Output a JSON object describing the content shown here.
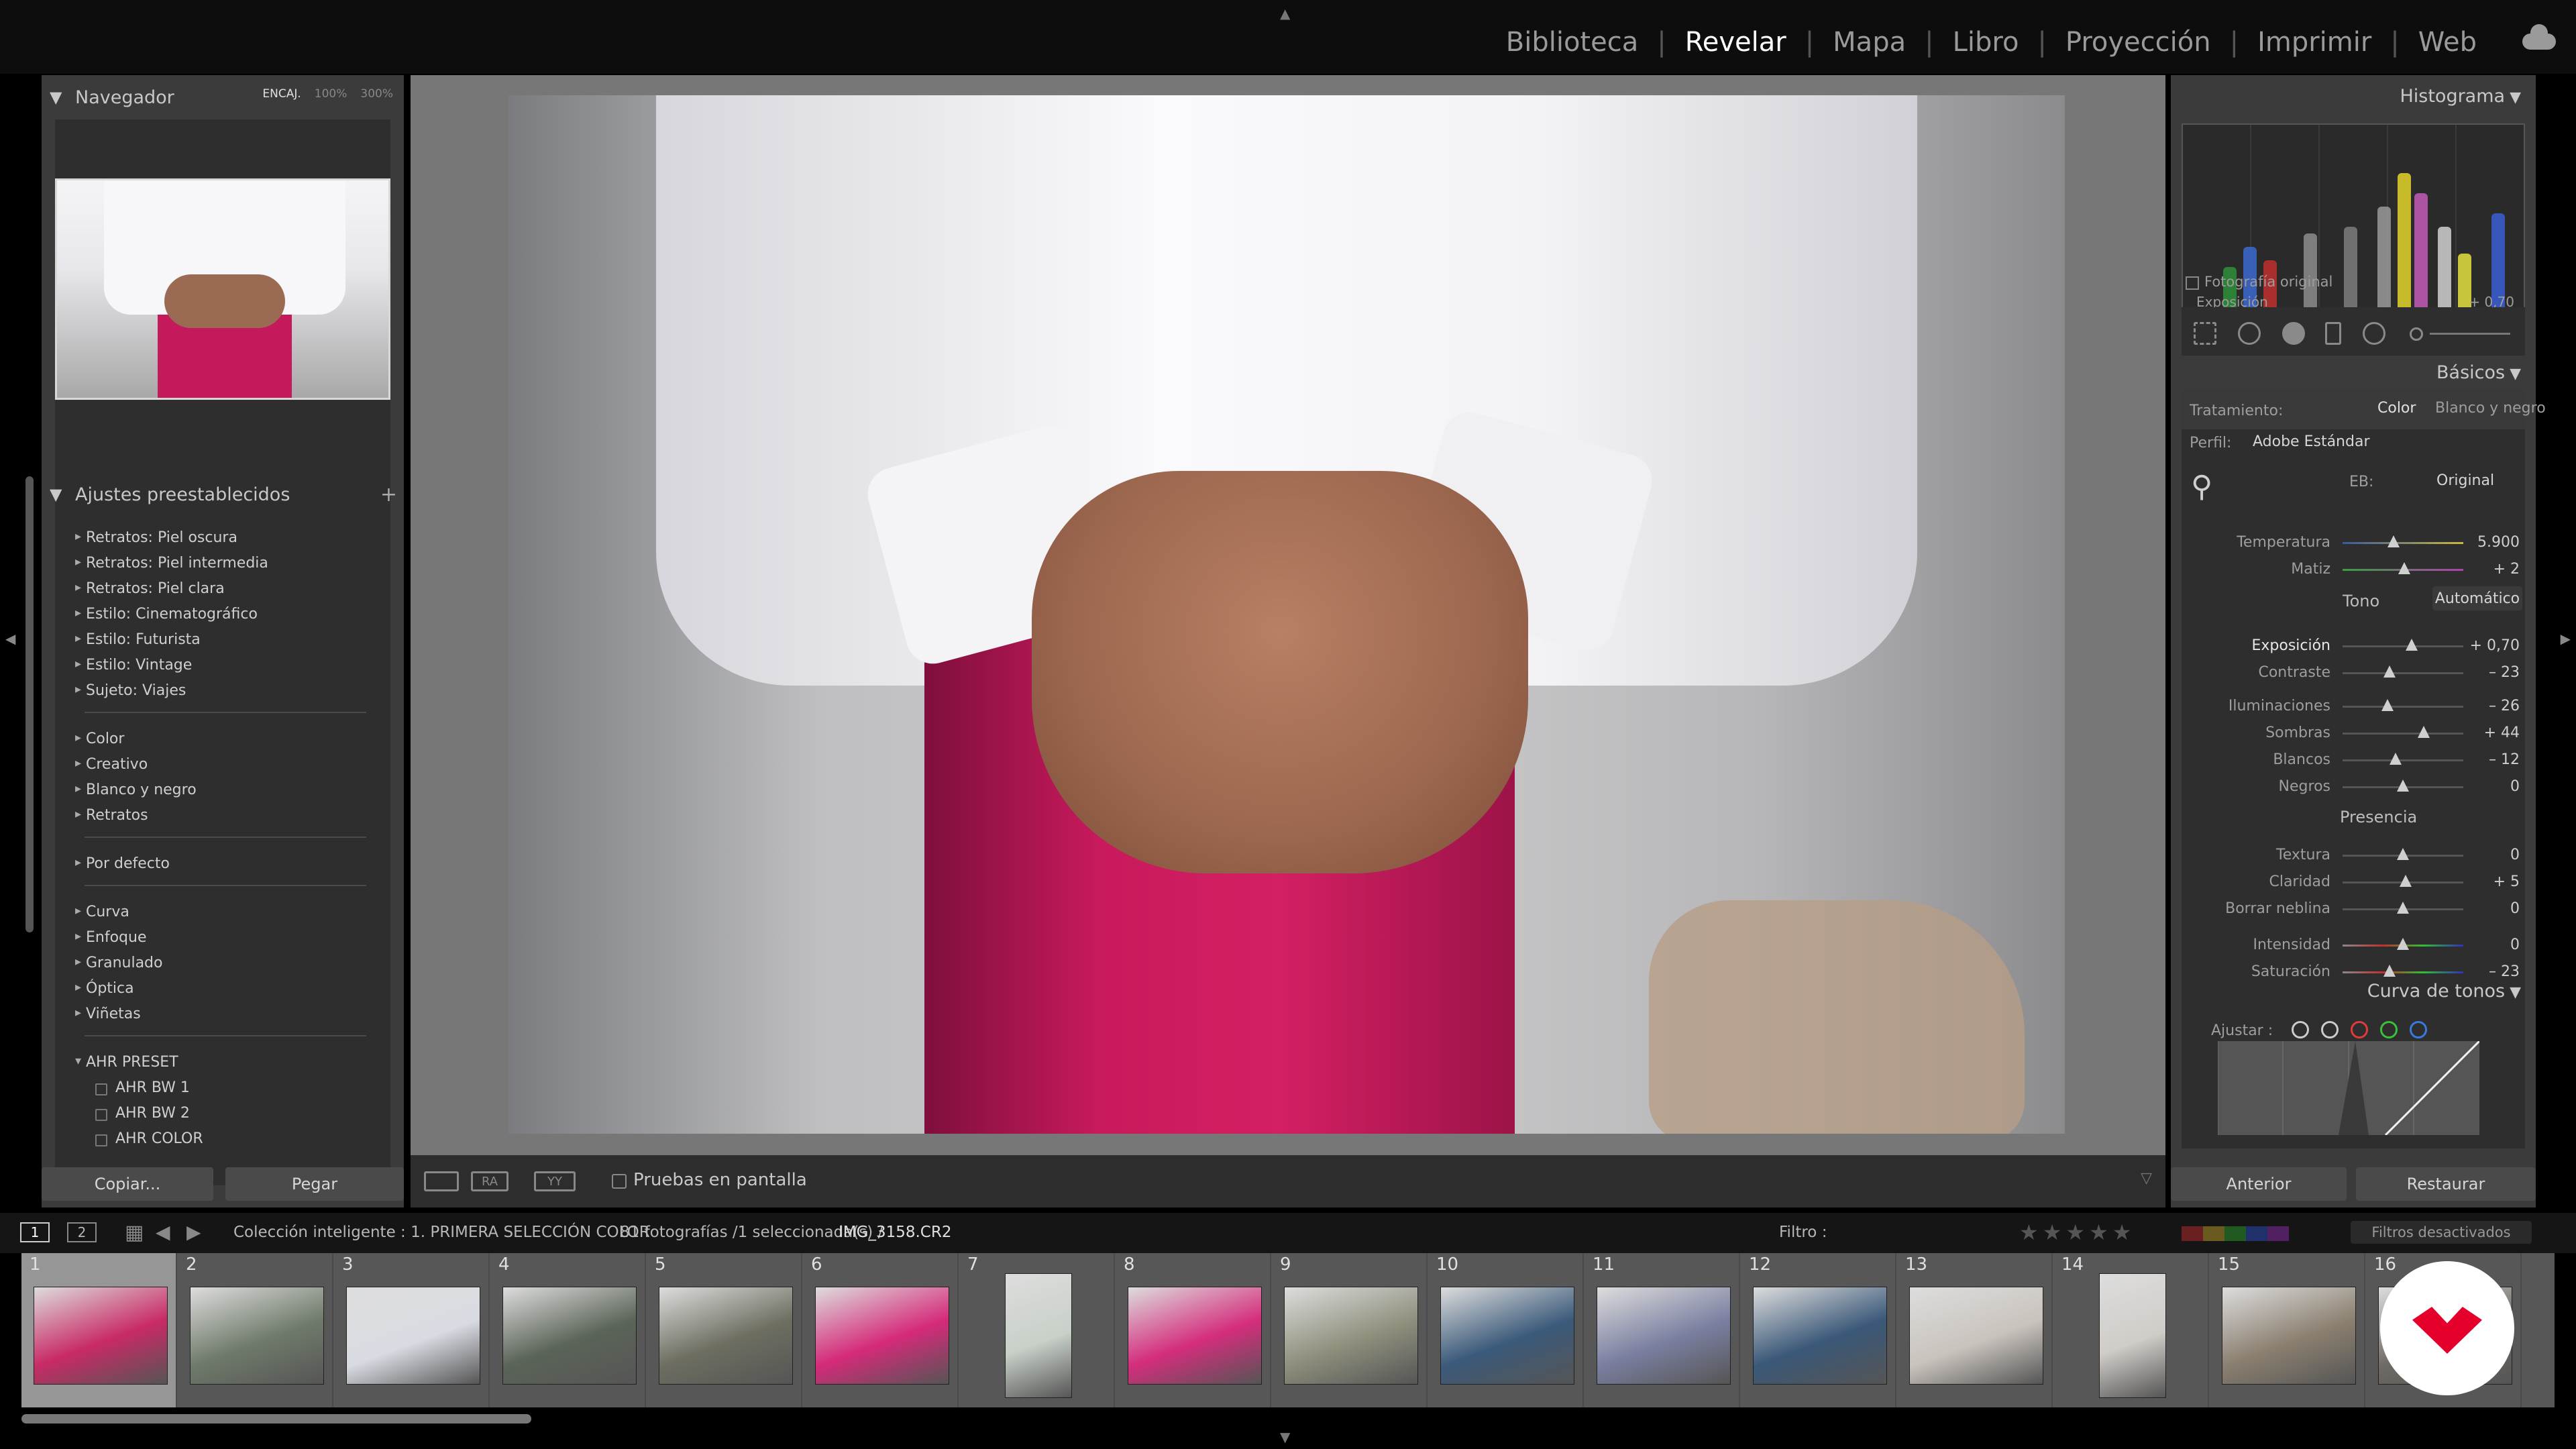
{
  "modules": [
    "Biblioteca",
    "Revelar",
    "Mapa",
    "Libro",
    "Proyección",
    "Imprimir",
    "Web"
  ],
  "active_module": "Revelar",
  "navigator": {
    "title": "Navegador",
    "zoom": [
      "ENCAJ.",
      "100%",
      "300%"
    ]
  },
  "presets": {
    "title": "Ajustes preestablecidos",
    "groups": [
      [
        "Retratos: Piel oscura",
        "Retratos: Piel intermedia",
        "Retratos: Piel clara",
        "Estilo: Cinematográfico",
        "Estilo: Futurista",
        "Estilo: Vintage",
        "Sujeto: Viajes"
      ],
      [
        "Color",
        "Creativo",
        "Blanco y negro",
        "Retratos"
      ],
      [
        "Por defecto"
      ],
      [
        "Curva",
        "Enfoque",
        "Granulado",
        "Óptica",
        "Viñetas"
      ]
    ],
    "ahr": {
      "title": "AHR PRESET",
      "items": [
        "AHR BW 1",
        "AHR BW 2",
        "AHR COLOR"
      ]
    }
  },
  "left_buttons": {
    "copy": "Copiar...",
    "paste": "Pegar"
  },
  "toolbar": {
    "proof": "Pruebas en pantalla"
  },
  "histogram": {
    "title": "Histograma",
    "exposure_label": "Exposición",
    "exposure_value": "+ 0,70",
    "original": "Fotografía original"
  },
  "basics": {
    "title": "Básicos",
    "treatment_label": "Tratamiento:",
    "treatment_color": "Color",
    "treatment_bw": "Blanco y negro",
    "profile_label": "Perfil:",
    "profile_value": "Adobe Estándar",
    "wb_label": "EB:",
    "wb_value": "Original",
    "tone_label": "Tono",
    "auto_label": "Automático",
    "presence_label": "Presencia",
    "sliders": [
      {
        "name": "Temperatura",
        "value": "5.900",
        "pos": 0.42
      },
      {
        "name": "Matiz",
        "value": "+ 2",
        "pos": 0.51
      },
      {
        "name": "Exposición",
        "value": "+ 0,70",
        "pos": 0.57
      },
      {
        "name": "Contraste",
        "value": "– 23",
        "pos": 0.39
      },
      {
        "name": "Iluminaciones",
        "value": "– 26",
        "pos": 0.37
      },
      {
        "name": "Sombras",
        "value": "+ 44",
        "pos": 0.67
      },
      {
        "name": "Blancos",
        "value": "– 12",
        "pos": 0.44
      },
      {
        "name": "Negros",
        "value": "0",
        "pos": 0.5
      },
      {
        "name": "Textura",
        "value": "0",
        "pos": 0.5
      },
      {
        "name": "Claridad",
        "value": "+ 5",
        "pos": 0.52
      },
      {
        "name": "Borrar neblina",
        "value": "0",
        "pos": 0.5
      },
      {
        "name": "Intensidad",
        "value": "0",
        "pos": 0.5
      },
      {
        "name": "Saturación",
        "value": "– 23",
        "pos": 0.39
      }
    ]
  },
  "curve": {
    "title": "Curva de tonos",
    "adjust_label": "Ajustar :"
  },
  "right_buttons": {
    "prev": "Anterior",
    "reset": "Restaurar"
  },
  "filmbar": {
    "page1": "1",
    "page2": "2",
    "collection": "Colección inteligente : 1. PRIMERA SELECCIÓN COLOR",
    "count": "81 fotografías /1 seleccionada(s) /",
    "file": "IMG_3158.CR2",
    "filter_label": "Filtro :",
    "filter_value": "Filtros desactivados"
  },
  "thumbs": [
    {
      "n": "1",
      "c": "#c82a66",
      "v": false
    },
    {
      "n": "2",
      "c": "#6f7a6a",
      "v": false
    },
    {
      "n": "3",
      "c": "#d8dbe2",
      "v": false
    },
    {
      "n": "4",
      "c": "#5b6458",
      "v": false
    },
    {
      "n": "5",
      "c": "#6d6e60",
      "v": false
    },
    {
      "n": "6",
      "c": "#d52a79",
      "v": false
    },
    {
      "n": "7",
      "c": "#c8d0c8",
      "v": true
    },
    {
      "n": "8",
      "c": "#d42d7c",
      "v": false
    },
    {
      "n": "9",
      "c": "#8e8f7c",
      "v": false
    },
    {
      "n": "10",
      "c": "#3b5a7a",
      "v": false
    },
    {
      "n": "11",
      "c": "#7a7fa0",
      "v": false
    },
    {
      "n": "12",
      "c": "#3a5878",
      "v": false
    },
    {
      "n": "13",
      "c": "#c9c3bd",
      "v": false
    },
    {
      "n": "14",
      "c": "#d0ccc8",
      "v": true
    },
    {
      "n": "15",
      "c": "#8b8070",
      "v": false
    },
    {
      "n": "16",
      "c": "#6e6a64",
      "v": false
    }
  ]
}
